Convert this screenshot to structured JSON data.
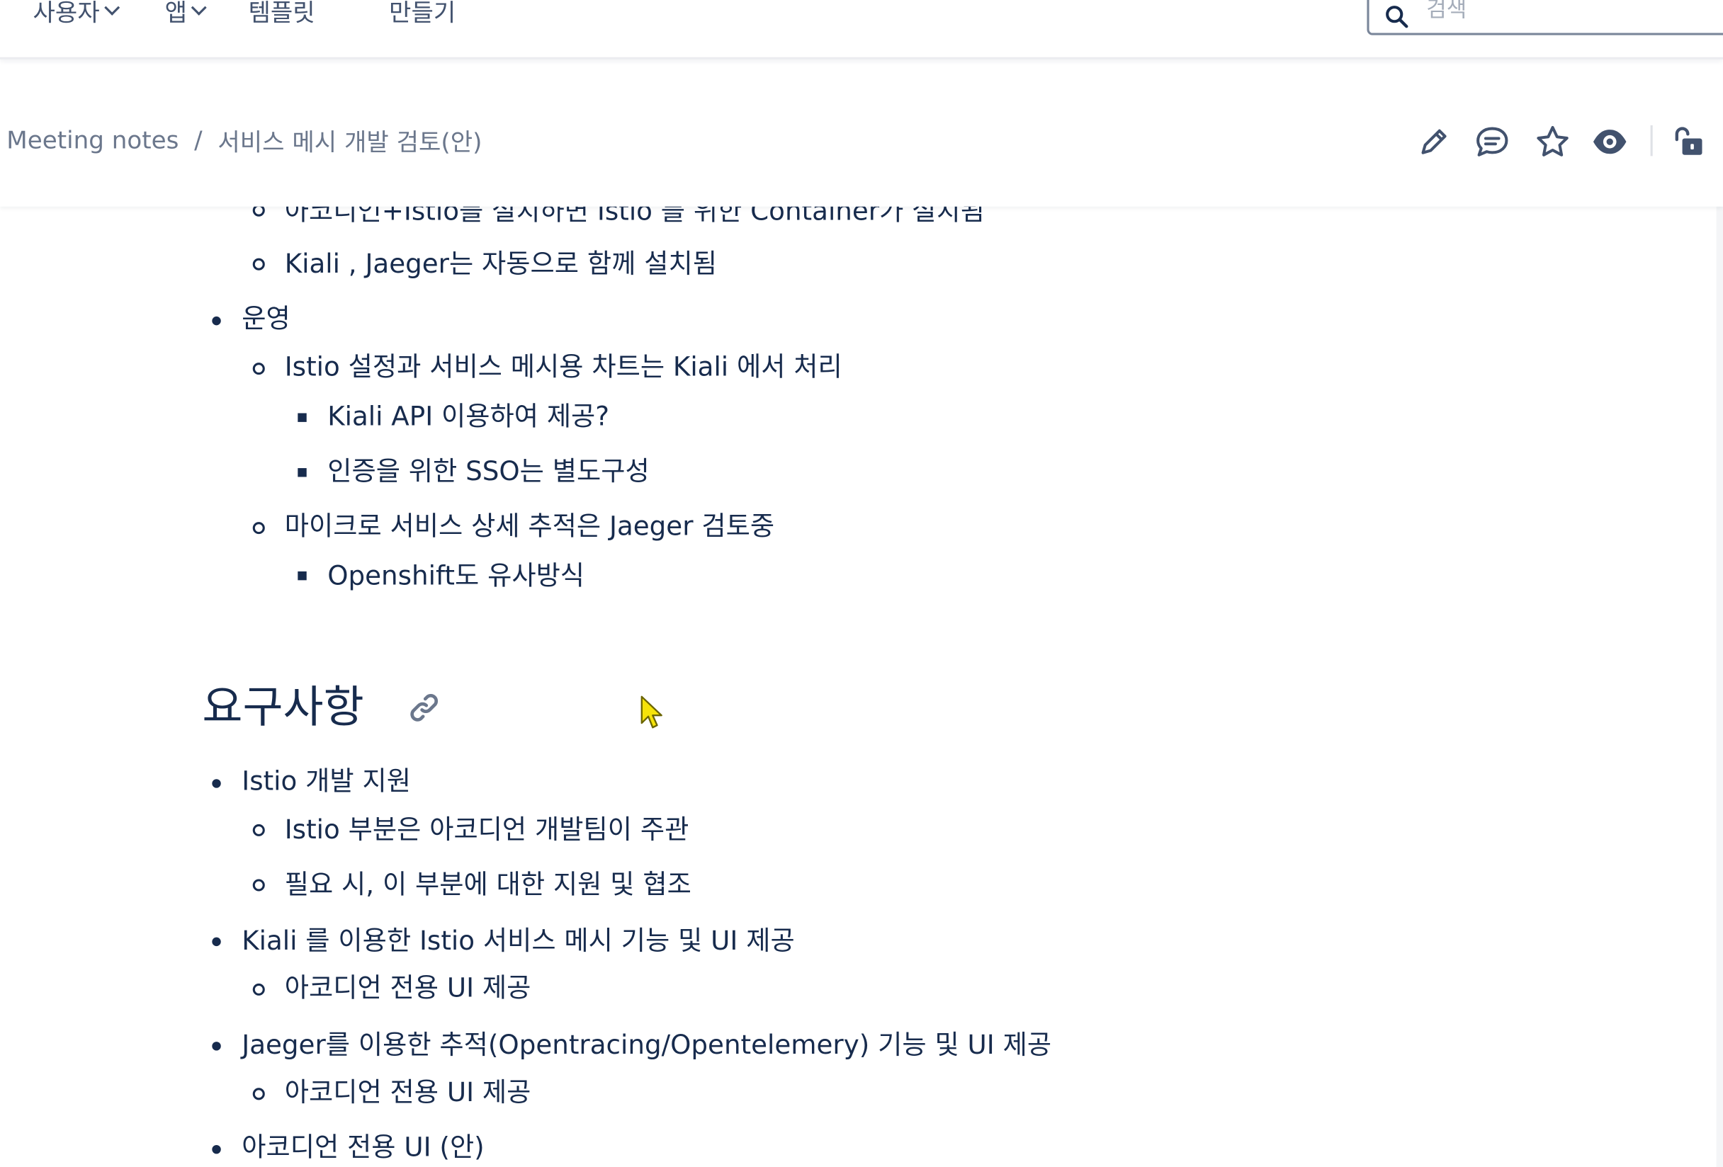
{
  "topnav": {
    "items": [
      {
        "label": "사용자",
        "has_dropdown": true
      },
      {
        "label": "앱",
        "has_dropdown": true
      },
      {
        "label": "템플릿",
        "has_dropdown": false
      },
      {
        "label": "만들기",
        "has_dropdown": false
      }
    ],
    "search": {
      "placeholder": "검색",
      "value": ""
    }
  },
  "breadcrumb": {
    "parent": "Meeting notes",
    "separator": "/",
    "current": "서비스 메시 개발 검토(안)"
  },
  "page_actions": {
    "icons": [
      "edit-icon",
      "comment-icon",
      "star-icon",
      "watch-icon",
      "unlock-icon"
    ]
  },
  "content": {
    "partial_line": "아코디언+Istio를 설치하면 Istio 를 위한 Container가 설치됨",
    "lines_top": [
      {
        "level": 2,
        "text": "Kiali , Jaeger는 자동으로 함께 설치됨"
      },
      {
        "level": 1,
        "text": "운영"
      },
      {
        "level": 2,
        "text": "Istio 설정과 서비스 메시용 차트는 Kiali 에서 처리"
      },
      {
        "level": 3,
        "text": "Kiali API 이용하여 제공?"
      },
      {
        "level": 3,
        "text": "인증을 위한 SSO는 별도구성"
      },
      {
        "level": 2,
        "text": "마이크로 서비스 상세 추적은 Jaeger 검토중"
      },
      {
        "level": 3,
        "text": "Openshift도 유사방식"
      }
    ],
    "heading": "요구사항",
    "lines_bottom": [
      {
        "level": 1,
        "text": "Istio 개발 지원"
      },
      {
        "level": 2,
        "text": "Istio 부분은 아코디언 개발팀이 주관"
      },
      {
        "level": 2,
        "text": "필요 시, 이 부분에 대한 지원 및 협조"
      },
      {
        "level": 1,
        "text": "Kiali 를 이용한 Istio 서비스 메시 기능 및 UI 제공"
      },
      {
        "level": 2,
        "text": "아코디언 전용 UI 제공"
      },
      {
        "level": 1,
        "text": "Jaeger를 이용한 추적(Opentracing/Opentelemery) 기능 및 UI 제공"
      },
      {
        "level": 2,
        "text": "아코디언 전용 UI 제공"
      },
      {
        "level": 1,
        "text": "아코디언 전용 UI (안)"
      }
    ]
  },
  "colors": {
    "text": "#172b4d",
    "muted": "#42526e",
    "breadcrumb": "#6b778c",
    "cursor": "#f5e30a"
  }
}
